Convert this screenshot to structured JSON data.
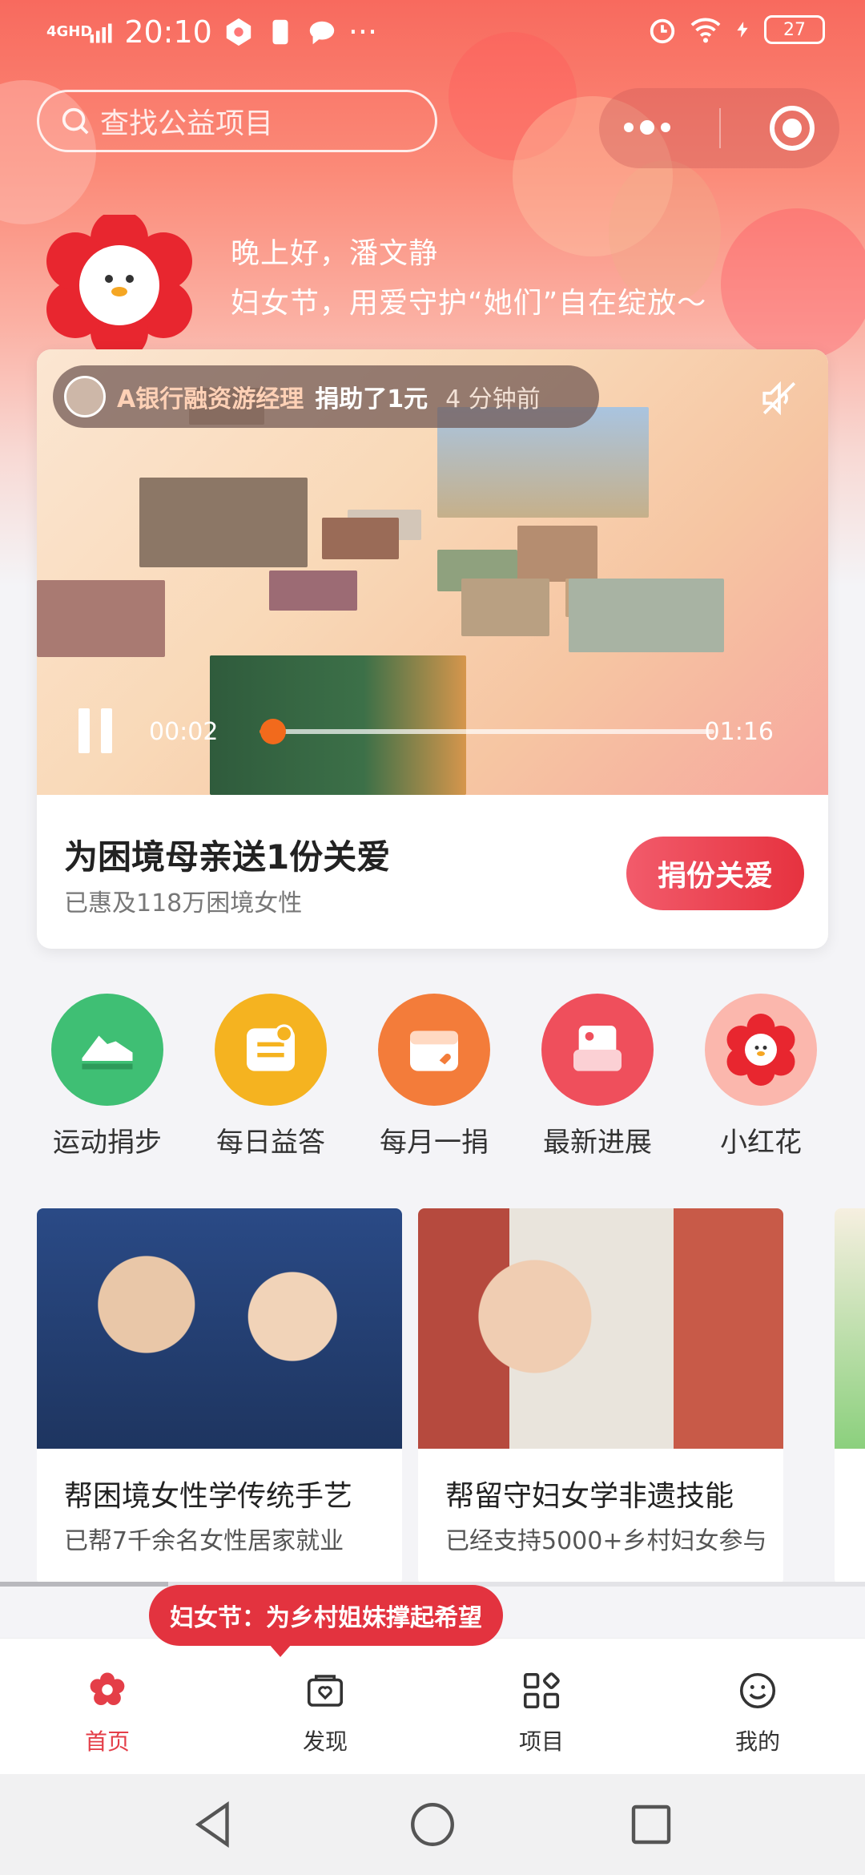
{
  "status_bar": {
    "network": "4GHD",
    "time": "20:10",
    "more": "···",
    "battery": "27"
  },
  "search": {
    "placeholder": "查找公益项目"
  },
  "greeting": {
    "line1": "晚上好，潘文静",
    "line2": "妇女节，用爱守护“她们”自在绽放～"
  },
  "video_card": {
    "notice": {
      "name": "A银行融资游经理",
      "action": "捐助了1元",
      "time": "4 分钟前"
    },
    "player": {
      "current_time": "00:02",
      "duration": "01:16",
      "progress": 0.03
    },
    "title": "为困境母亲送1份关爱",
    "subtitle": "已惠及118万困境女性",
    "donate_label": "捐份关爱"
  },
  "shortcuts": [
    {
      "label": "运动捐步",
      "color": "#3fbf74",
      "icon": "sneaker-icon"
    },
    {
      "label": "每日益答",
      "color": "#f5b320",
      "icon": "quiz-icon"
    },
    {
      "label": "每月一捐",
      "color": "#f37c3a",
      "icon": "calendar-icon"
    },
    {
      "label": "最新进展",
      "color": "#ef4f5c",
      "icon": "inbox-icon"
    },
    {
      "label": "小红花",
      "color": "#f87a6f",
      "icon": "flower-icon"
    }
  ],
  "promos": [
    {
      "title": "帮困境女性学传统手艺",
      "subtitle": "已帮7千余名女性居家就业"
    },
    {
      "title": "帮留守妇女学非遗技能",
      "subtitle": "已经支持5000+乡村妇女参与"
    }
  ],
  "banner": {
    "text": "妇女节：为乡村姐妹撑起希望"
  },
  "tabs": [
    {
      "label": "首页",
      "active": true
    },
    {
      "label": "发现",
      "active": false
    },
    {
      "label": "项目",
      "active": false
    },
    {
      "label": "我的",
      "active": false
    }
  ],
  "colors": {
    "accent": "#e43e48",
    "progress": "#f26a1c"
  }
}
